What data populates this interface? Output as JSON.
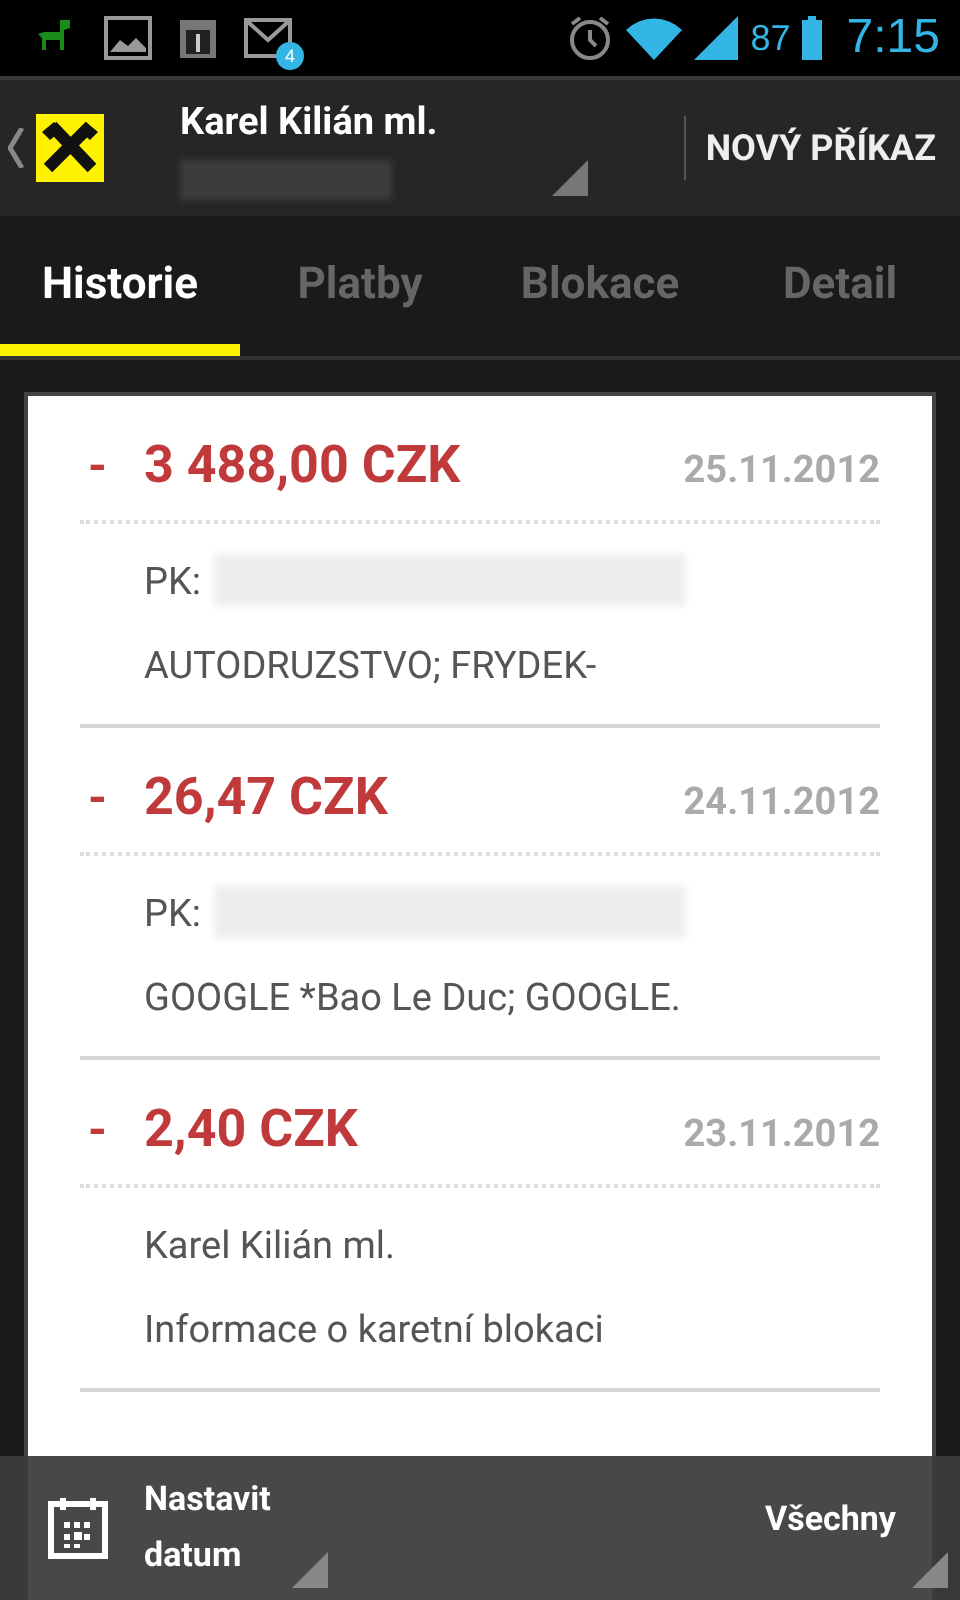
{
  "status_bar": {
    "notification_badge": "4",
    "battery": "87",
    "time": "7:15"
  },
  "action_bar": {
    "account_name": "Karel Kilián ml.",
    "action": "NOVÝ PŘÍKAZ"
  },
  "tabs": [
    {
      "label": "Historie",
      "selected": true
    },
    {
      "label": "Platby",
      "selected": false
    },
    {
      "label": "Blokace",
      "selected": false
    },
    {
      "label": "Detail",
      "selected": false
    }
  ],
  "transactions": [
    {
      "sign": "-",
      "amount": "3 488,00 CZK",
      "date": "25.11.2012",
      "line_1": "PK:",
      "line_1_redacted": true,
      "line_2": "AUTODRUZSTVO; FRYDEK-"
    },
    {
      "sign": "-",
      "amount": "26,47 CZK",
      "date": "24.11.2012",
      "line_1": "PK:",
      "line_1_redacted": true,
      "line_2": "GOOGLE *Bao Le Duc; GOOGLE."
    },
    {
      "sign": "-",
      "amount": "2,40 CZK",
      "date": "23.11.2012",
      "line_1": "Karel Kilián ml.",
      "line_1_redacted": false,
      "line_2": "Informace o karetní blokaci"
    }
  ],
  "bottom_bar": {
    "date_button": "Nastavit datum",
    "filter": "Všechny"
  }
}
